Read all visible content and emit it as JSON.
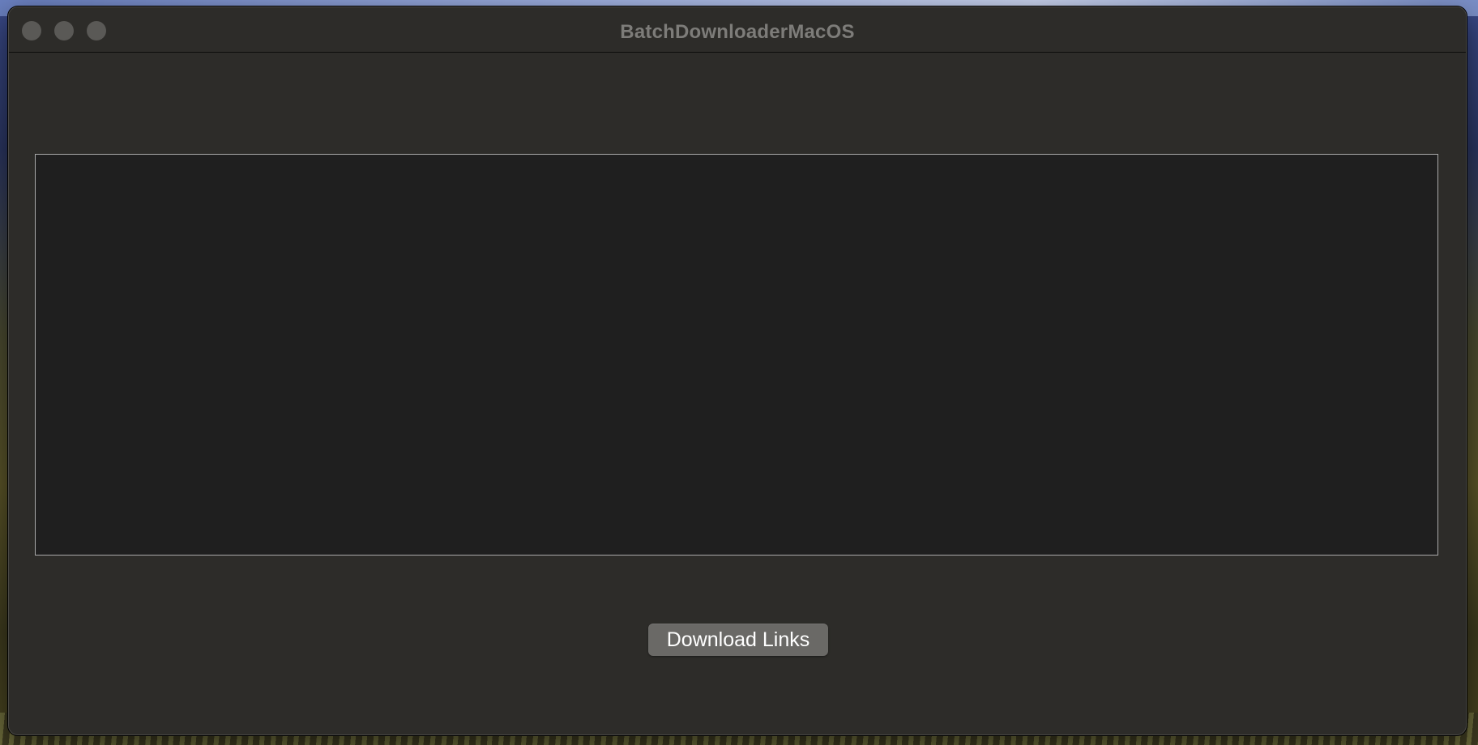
{
  "window": {
    "title": "BatchDownloaderMacOS"
  },
  "links_input": {
    "value": "",
    "placeholder": ""
  },
  "actions": {
    "download_label": "Download Links"
  },
  "colors": {
    "window_background": "#2d2c29",
    "textarea_background": "#1f1f1f",
    "textarea_border": "#a9a9a9",
    "button_background": "#6a6966",
    "title_text": "#7d7c79"
  }
}
